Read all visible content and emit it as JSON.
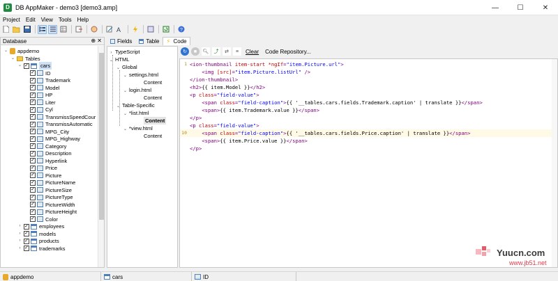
{
  "window": {
    "title": "DB AppMaker - demo3 [demo3.amp]",
    "logo_letter": "D",
    "minimize": "—",
    "maximize": "☐",
    "close": "✕"
  },
  "menu": [
    "Project",
    "Edit",
    "View",
    "Tools",
    "Help"
  ],
  "database_panel": {
    "title": "Database",
    "pin": "⊕ ✕",
    "root": "appdemo",
    "tables_folder": "Tables",
    "selected_table": "cars",
    "fields": [
      "ID",
      "Trademark",
      "Model",
      "HP",
      "Liter",
      "Cyl",
      "TransmissSpeedCour",
      "TransmissAutomatic",
      "MPG_City",
      "MPG_Highway",
      "Category",
      "Description",
      "Hyperlink",
      "Price",
      "Picture",
      "PictureName",
      "PictureSize",
      "PictureType",
      "PictureWidth",
      "PictureHeight",
      "Color"
    ],
    "other_tables": [
      "employees",
      "models",
      "products",
      "trademarks"
    ]
  },
  "tabs": [
    "Fields",
    "Table",
    "Code"
  ],
  "structure_tree": {
    "typescript": "TypeScript",
    "html": "HTML",
    "global": "Global",
    "settings": "settings.html",
    "content1": "Content",
    "login": "login.html",
    "content2": "Content",
    "table_specific": "Table-Specific",
    "list": "*list.html",
    "content3": "Content",
    "view": "*view.html",
    "content4": "Content"
  },
  "editor_toolbar": {
    "clear": "Clear",
    "code_repository": "Code Repository..."
  },
  "code_lines": [
    {
      "n": "1",
      "parts": [
        [
          "tag",
          "<ion-thumbnail "
        ],
        [
          "attr",
          "item-start "
        ],
        [
          "attr",
          "*ngIf"
        ],
        [
          "tag",
          "="
        ],
        [
          "val",
          "\"item.Picture.url\""
        ],
        [
          "tag",
          ">"
        ]
      ]
    },
    {
      "n": "",
      "parts": [
        [
          "text",
          "    "
        ],
        [
          "tag",
          "<img "
        ],
        [
          "attr",
          "[src]"
        ],
        [
          "tag",
          "="
        ],
        [
          "val",
          "\"item.Picture.listUrl\""
        ],
        [
          "tag",
          " />"
        ]
      ]
    },
    {
      "n": "",
      "parts": [
        [
          "tag",
          "</ion-thumbnail>"
        ]
      ]
    },
    {
      "n": "",
      "parts": [
        [
          "tag",
          "<h2>"
        ],
        [
          "text",
          "{{ item.Model }}"
        ],
        [
          "tag",
          "</h2>"
        ]
      ]
    },
    {
      "n": "",
      "parts": [
        [
          "tag",
          "<p "
        ],
        [
          "attr",
          "class"
        ],
        [
          "tag",
          "="
        ],
        [
          "val",
          "\"field-value\""
        ],
        [
          "tag",
          ">"
        ]
      ]
    },
    {
      "n": "",
      "parts": [
        [
          "text",
          "    "
        ],
        [
          "tag",
          "<span "
        ],
        [
          "attr",
          "class"
        ],
        [
          "tag",
          "="
        ],
        [
          "val",
          "\"field-caption\""
        ],
        [
          "tag",
          ">"
        ],
        [
          "text",
          "{{ '__tables.cars.fields.Trademark.caption' | translate }}"
        ],
        [
          "tag",
          "</span>"
        ]
      ]
    },
    {
      "n": "",
      "parts": [
        [
          "text",
          "    "
        ],
        [
          "tag",
          "<span>"
        ],
        [
          "text",
          "{{ item.Trademark.value }}"
        ],
        [
          "tag",
          "</span>"
        ]
      ]
    },
    {
      "n": "",
      "parts": [
        [
          "tag",
          "</p>"
        ]
      ]
    },
    {
      "n": "",
      "parts": [
        [
          "tag",
          "<p "
        ],
        [
          "attr",
          "class"
        ],
        [
          "tag",
          "="
        ],
        [
          "val",
          "\"field-value\""
        ],
        [
          "tag",
          ">"
        ]
      ]
    },
    {
      "n": "10",
      "parts": [
        [
          "text",
          "    "
        ],
        [
          "tag",
          "<span "
        ],
        [
          "attr",
          "class"
        ],
        [
          "tag",
          "="
        ],
        [
          "val",
          "\"field-caption\""
        ],
        [
          "tag",
          ">"
        ],
        [
          "text",
          "{{ '__tables.cars.fields.Price.caption' | translate }}"
        ],
        [
          "tag",
          "</span>"
        ]
      ]
    },
    {
      "n": "",
      "parts": [
        [
          "text",
          "    "
        ],
        [
          "tag",
          "<span>"
        ],
        [
          "text",
          "{{ item.Price.value }}"
        ],
        [
          "tag",
          "</span>"
        ]
      ]
    },
    {
      "n": "",
      "parts": [
        [
          "tag",
          "</p>"
        ]
      ]
    }
  ],
  "status": {
    "db": "appdemo",
    "table": "cars",
    "field": "ID"
  },
  "watermark": {
    "line1": "Yuucn.com",
    "line2": "www.jb51.net"
  },
  "colors": {
    "accent": "#1e8b3e",
    "selection": "#cde0f5",
    "tag": "#800080",
    "attr": "#c00000",
    "value": "#0000ff"
  }
}
